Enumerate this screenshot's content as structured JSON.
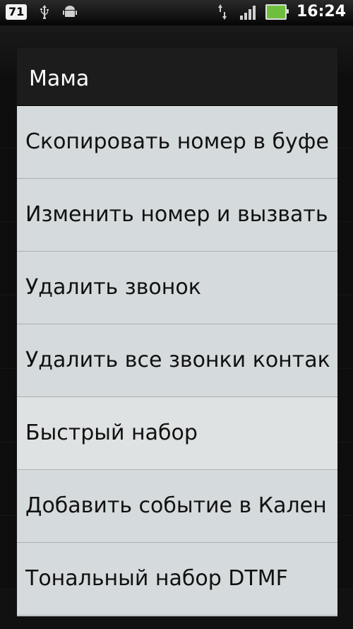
{
  "status_bar": {
    "notification_count": "71",
    "time": "16:24"
  },
  "dialog": {
    "title": "Мама",
    "items": [
      {
        "label": "Скопировать номер в буфе"
      },
      {
        "label": "Изменить номер и вызвать"
      },
      {
        "label": "Удалить звонок"
      },
      {
        "label": "Удалить все звонки контак"
      },
      {
        "label": "Быстрый набор",
        "highlighted": true
      },
      {
        "label": "Добавить событие в Кален"
      },
      {
        "label": "Тональный набор DTMF"
      }
    ]
  },
  "colors": {
    "dialog_background": "#d5dadc",
    "dialog_title_background": "#1c1c1c",
    "highlight": "#dfe2e2"
  },
  "icons": [
    "usb-icon",
    "android-icon",
    "data-transfer-icon",
    "signal-icon",
    "battery-icon"
  ]
}
